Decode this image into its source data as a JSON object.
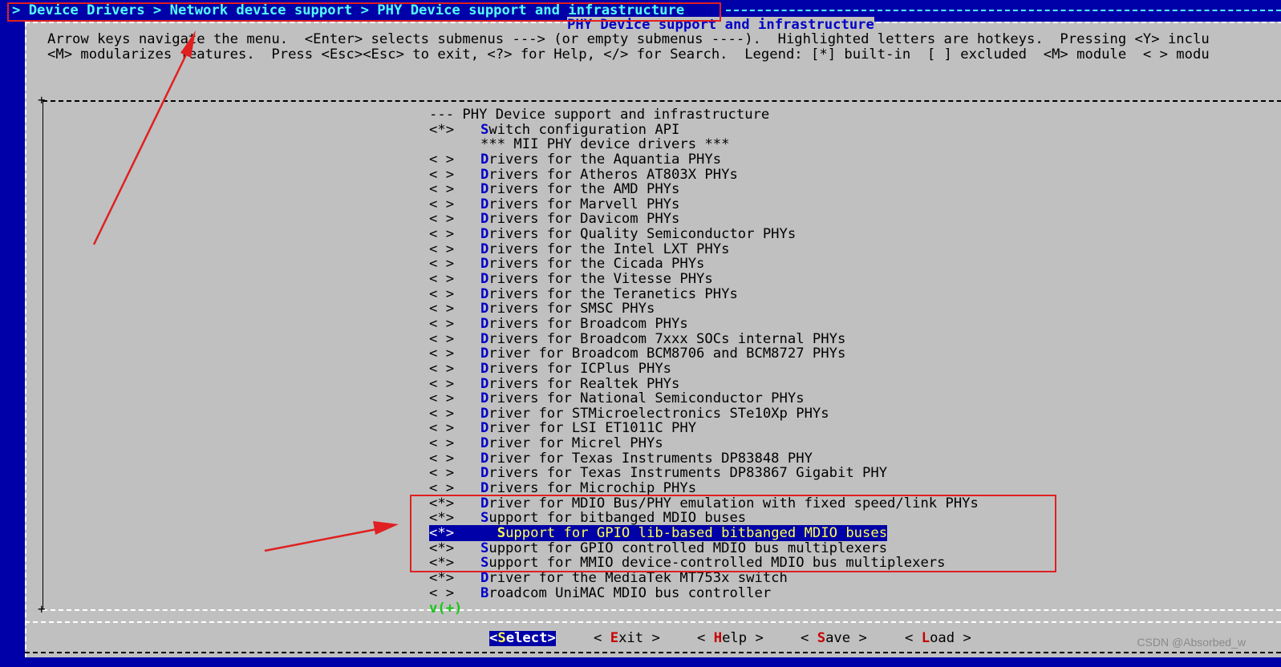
{
  "breadcrumb": "> Device Drivers > Network device support > PHY Device support and infrastructure",
  "window_title": "PHY Device support and infrastructure",
  "help_text": [
    "Arrow keys navigate the menu.  <Enter> selects submenus ---> (or empty submenus ----).  Highlighted letters are hotkeys.  Pressing <Y> inclu",
    "<M> modularizes features.  Press <Esc><Esc> to exit, <?> for Help, </> for Search.  Legend: [*] built-in  [ ] excluded  <M> module  < > modu"
  ],
  "menu_items": [
    {
      "state": "",
      "hot": "",
      "rest": "--- PHY Device support and infrastructure",
      "indent": false
    },
    {
      "state": "<*>",
      "hot": "S",
      "rest": "witch configuration API",
      "indent": false
    },
    {
      "state": "",
      "hot": "",
      "rest": "*** MII PHY device drivers ***",
      "indent": false,
      "comment": true
    },
    {
      "state": "< >",
      "hot": "D",
      "rest": "rivers for the Aquantia PHYs",
      "indent": false
    },
    {
      "state": "< >",
      "hot": "D",
      "rest": "rivers for Atheros AT803X PHYs",
      "indent": false
    },
    {
      "state": "< >",
      "hot": "D",
      "rest": "rivers for the AMD PHYs",
      "indent": false
    },
    {
      "state": "< >",
      "hot": "D",
      "rest": "rivers for Marvell PHYs",
      "indent": false
    },
    {
      "state": "< >",
      "hot": "D",
      "rest": "rivers for Davicom PHYs",
      "indent": false
    },
    {
      "state": "< >",
      "hot": "D",
      "rest": "rivers for Quality Semiconductor PHYs",
      "indent": false
    },
    {
      "state": "< >",
      "hot": "D",
      "rest": "rivers for the Intel LXT PHYs",
      "indent": false
    },
    {
      "state": "< >",
      "hot": "D",
      "rest": "rivers for the Cicada PHYs",
      "indent": false
    },
    {
      "state": "< >",
      "hot": "D",
      "rest": "rivers for the Vitesse PHYs",
      "indent": false
    },
    {
      "state": "< >",
      "hot": "D",
      "rest": "rivers for the Teranetics PHYs",
      "indent": false
    },
    {
      "state": "< >",
      "hot": "D",
      "rest": "rivers for SMSC PHYs",
      "indent": false
    },
    {
      "state": "< >",
      "hot": "D",
      "rest": "rivers for Broadcom PHYs",
      "indent": false
    },
    {
      "state": "< >",
      "hot": "D",
      "rest": "rivers for Broadcom 7xxx SOCs internal PHYs",
      "indent": false
    },
    {
      "state": "< >",
      "hot": "D",
      "rest": "river for Broadcom BCM8706 and BCM8727 PHYs",
      "indent": false
    },
    {
      "state": "< >",
      "hot": "D",
      "rest": "rivers for ICPlus PHYs",
      "indent": false
    },
    {
      "state": "< >",
      "hot": "D",
      "rest": "rivers for Realtek PHYs",
      "indent": false
    },
    {
      "state": "< >",
      "hot": "D",
      "rest": "rivers for National Semiconductor PHYs",
      "indent": false
    },
    {
      "state": "< >",
      "hot": "D",
      "rest": "river for STMicroelectronics STe10Xp PHYs",
      "indent": false
    },
    {
      "state": "< >",
      "hot": "D",
      "rest": "river for LSI ET1011C PHY",
      "indent": false
    },
    {
      "state": "< >",
      "hot": "D",
      "rest": "river for Micrel PHYs",
      "indent": false
    },
    {
      "state": "< >",
      "hot": "D",
      "rest": "river for Texas Instruments DP83848 PHY",
      "indent": false
    },
    {
      "state": "< >",
      "hot": "D",
      "rest": "rivers for Texas Instruments DP83867 Gigabit PHY",
      "indent": false
    },
    {
      "state": "< >",
      "hot": "D",
      "rest": "rivers for Microchip PHYs",
      "indent": false
    },
    {
      "state": "<*>",
      "hot": "D",
      "rest": "river for MDIO Bus/PHY emulation with fixed speed/link PHYs",
      "indent": false
    },
    {
      "state": "<*>",
      "hot": "S",
      "rest": "upport for bitbanged MDIO buses",
      "indent": false
    },
    {
      "state": "<*>",
      "hot": "S",
      "rest": "upport for GPIO lib-based bitbanged MDIO buses",
      "indent": true,
      "selected": true
    },
    {
      "state": "<*>",
      "hot": "S",
      "rest": "upport for GPIO controlled MDIO bus multiplexers",
      "indent": false
    },
    {
      "state": "<*>",
      "hot": "S",
      "rest": "upport for MMIO device-controlled MDIO bus multiplexers",
      "indent": false
    },
    {
      "state": "<*>",
      "hot": "D",
      "rest": "river for the MediaTek MT753x switch",
      "indent": false
    },
    {
      "state": "< >",
      "hot": "B",
      "rest": "roadcom UniMAC MDIO bus controller",
      "indent": false
    }
  ],
  "more_indicator": "v(+)",
  "buttons": {
    "select": {
      "pre": "<",
      "hot": "S",
      "post": "elect>"
    },
    "exit": {
      "pre": "< ",
      "hot": "E",
      "post": "xit >"
    },
    "help": {
      "pre": "< ",
      "hot": "H",
      "post": "elp >"
    },
    "save": {
      "pre": "< ",
      "hot": "S",
      "post": "ave >"
    },
    "load": {
      "pre": "< ",
      "hot": "L",
      "post": "oad >"
    }
  },
  "watermark": "CSDN @Absorbed_w",
  "colors": {
    "background": "#0000a8",
    "window": "#c0c0c0",
    "breadcrumb_text": "#55ffff",
    "hotkey": "#0000c8",
    "selected_bg": "#0000a8",
    "selected_text": "#ffff55",
    "annotation_red": "#e02020"
  }
}
